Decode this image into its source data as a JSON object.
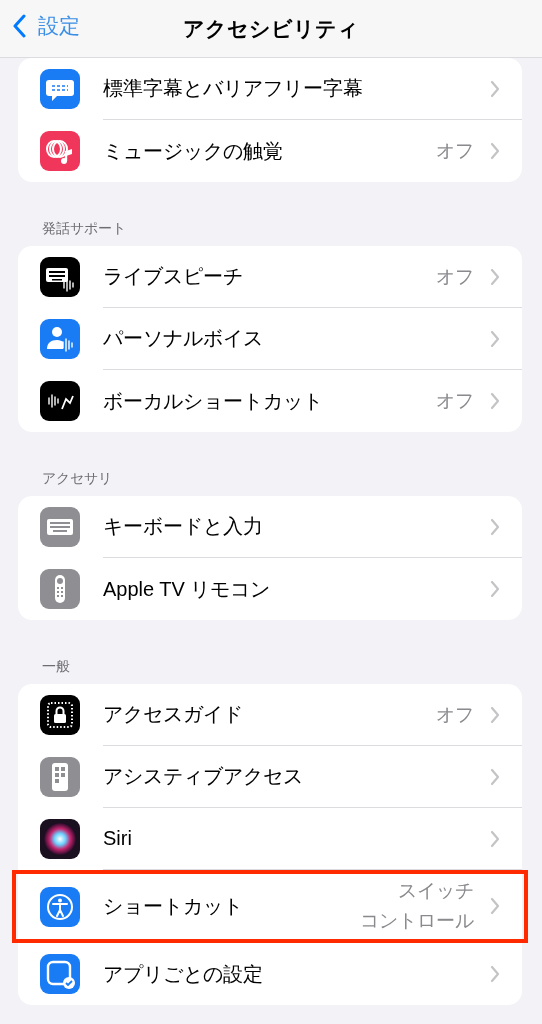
{
  "nav": {
    "back": "設定",
    "title": "アクセシビリティ"
  },
  "sections": [
    {
      "rows": [
        {
          "label": "標準字幕とバリアフリー字幕",
          "highlighted": false
        },
        {
          "label": "ミュージックの触覚",
          "value": "オフ",
          "highlighted": false
        }
      ]
    },
    {
      "header": "発話サポート",
      "rows": [
        {
          "label": "ライブスピーチ",
          "value": "オフ",
          "highlighted": false
        },
        {
          "label": "パーソナルボイス",
          "highlighted": false
        },
        {
          "label": "ボーカルショートカット",
          "value": "オフ",
          "highlighted": false
        }
      ]
    },
    {
      "header": "アクセサリ",
      "rows": [
        {
          "label": "キーボードと入力",
          "highlighted": false
        },
        {
          "label": "Apple TV リモコン",
          "highlighted": false
        }
      ]
    },
    {
      "header": "一般",
      "rows": [
        {
          "label": "アクセスガイド",
          "value": "オフ",
          "highlighted": false
        },
        {
          "label": "アシスティブアクセス",
          "highlighted": false
        },
        {
          "label": "Siri",
          "highlighted": false
        },
        {
          "label": "ショートカット",
          "value_lines": [
            "スイッチ",
            "コントロール"
          ],
          "highlighted": true
        },
        {
          "label": "アプリごとの設定",
          "highlighted": false
        }
      ]
    }
  ]
}
